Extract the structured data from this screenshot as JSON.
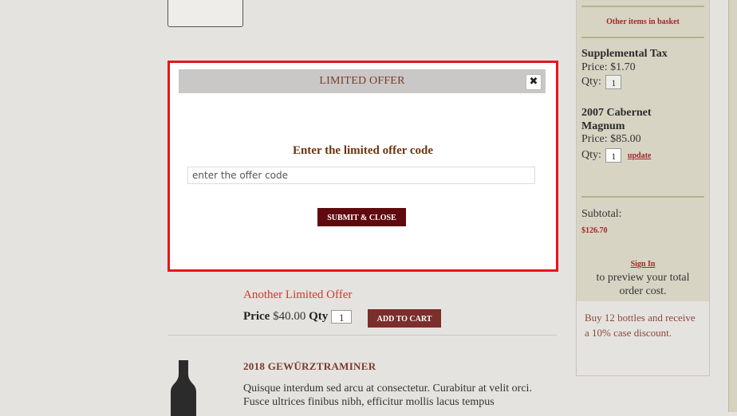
{
  "modal": {
    "title": "LIMITED OFFER",
    "close_label": "✖",
    "heading": "Enter the limited offer code",
    "input_placeholder": "enter the offer code",
    "input_value": "",
    "submit_label": "SUBMIT & CLOSE"
  },
  "product": {
    "title": "Another Limited Offer",
    "price_label": "Price",
    "price": "$40.00",
    "qty_label": "Qty",
    "qty": "1",
    "add_to_cart": "ADD TO CART"
  },
  "wine": {
    "title": "2018 GEWÜRZTRAMINER",
    "description": "Quisque interdum sed arcu at consectetur. Curabitur at velit orci. Fusce ultrices finibus nibh, efficitur mollis lacus tempus"
  },
  "sidebar": {
    "other_items": "Other items in basket",
    "items": [
      {
        "name": "Supplemental Tax",
        "price_label": "Price:",
        "price": "$1.70",
        "qty_label": "Qty:",
        "qty": "1"
      },
      {
        "name": "2007 Cabernet Magnum",
        "price_label": "Price:",
        "price": "$85.00",
        "qty_label": "Qty:",
        "qty": "1",
        "update_label": "update"
      }
    ],
    "subtotal_label": "Subtotal:",
    "subtotal_value": "$126.70",
    "sign_in": "Sign In",
    "preview_text": "to preview your total order cost.",
    "promo": "Buy 12 bottles and receive a 10% case discount."
  },
  "colors": {
    "modal_border": "#e8141b",
    "button_dark": "#5f0a0f",
    "accent_red": "#a2282a"
  }
}
